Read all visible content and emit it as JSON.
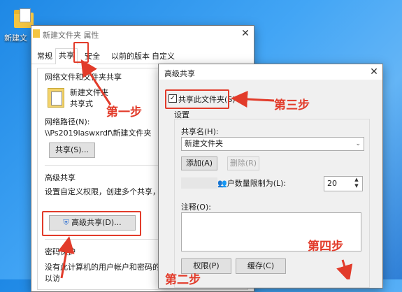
{
  "desktop": {
    "icon_label": "新建文"
  },
  "props_window": {
    "title": "新建文件夹 属性",
    "tabs": [
      "常规",
      "共享",
      "安全",
      "以前的版本",
      "自定义"
    ],
    "network_section": "网络文件和文件夹共享",
    "folder_name": "新建文件夹",
    "share_state": "共享式",
    "network_path_label": "网络路径(N):",
    "network_path": "\\\\Ps2019laswxrdf\\新建文件夹",
    "share_button": "共享(S)...",
    "advanced_section": "高级共享",
    "advanced_desc": "设置自定义权限，创建多个共享，并设置",
    "advanced_button": "高级共享(D)...",
    "password_section": "密码保护",
    "password_desc": "没有此计算机的用户帐户和密码的用户可",
    "password_desc2": "以访"
  },
  "adv_dialog": {
    "title": "高级共享",
    "share_checkbox": "共享此文件夹(S)",
    "share_checked": true,
    "settings_label": "设置",
    "share_name_label": "共享名(H):",
    "share_name_value": "新建文件夹",
    "add_button": "添加(A)",
    "remove_button": "删除(R)",
    "limit_label": "户数量限制为(L):",
    "limit_value": "20",
    "comment_label": "注释(O):",
    "perm_button": "权限(P)",
    "cache_button": "缓存(C)"
  },
  "annotations": {
    "step1": "第一步",
    "step2": "第二步",
    "step3": "第三步",
    "step4": "第四步",
    "color": "#e23b2a"
  }
}
